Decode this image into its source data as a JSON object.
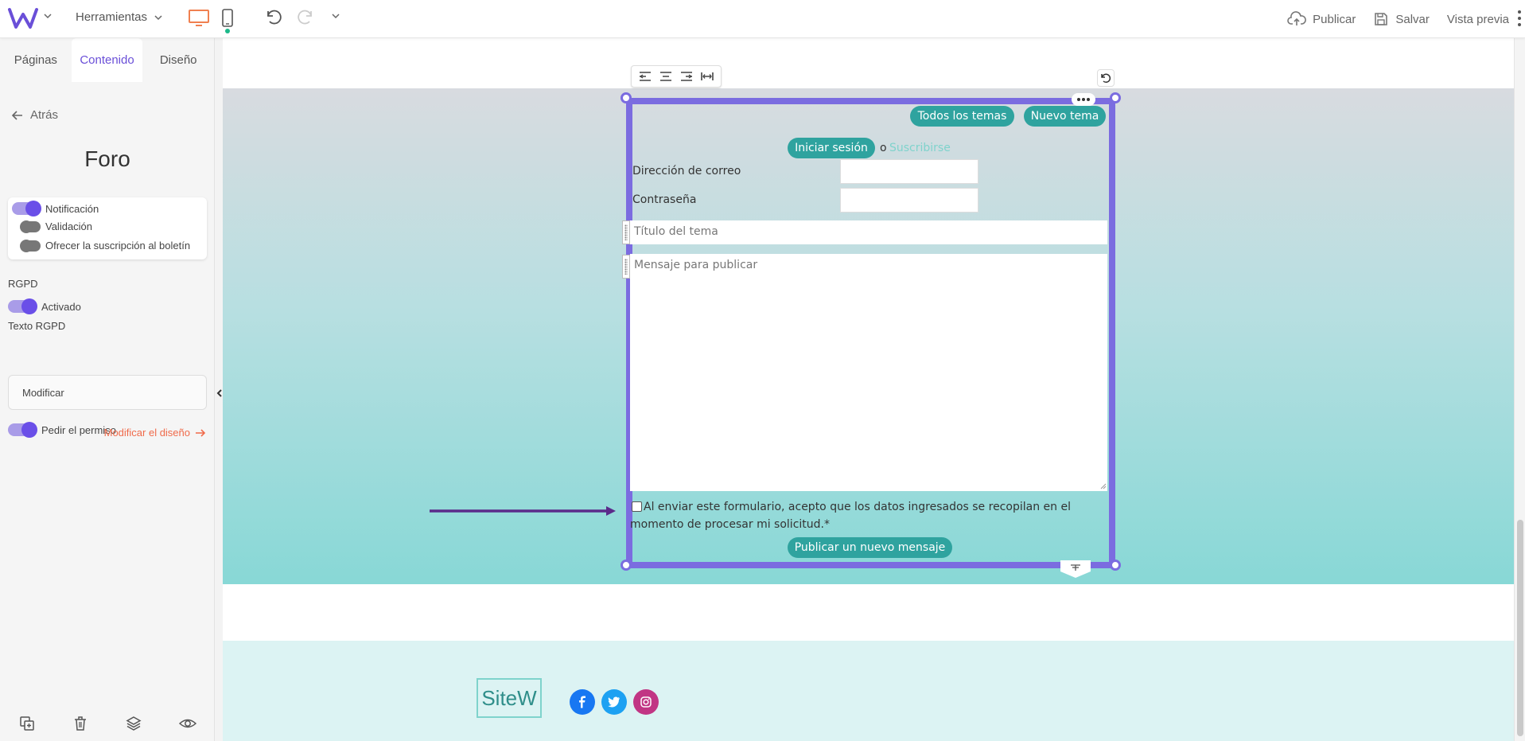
{
  "topbar": {
    "tools_label": "Herramientas",
    "publish_label": "Publicar",
    "save_label": "Salvar",
    "preview_label": "Vista previa",
    "colors": {
      "accent": "#6a4fd8",
      "desktop_icon": "#f08050",
      "mobile_dot": "#1cb98a"
    }
  },
  "left_panel": {
    "tabs": [
      {
        "label": "Páginas"
      },
      {
        "label": "Contenido"
      },
      {
        "label": "Diseño"
      }
    ],
    "back_label": "Atrás",
    "title": "Foro",
    "options": [
      {
        "label": "Notificación",
        "on": true
      },
      {
        "label": "Validación",
        "on": false
      },
      {
        "label": "Ofrecer la suscripción al boletín",
        "on": false
      }
    ],
    "rgpd_heading": "RGPD",
    "rgpd_activated_label": "Activado",
    "rgpd_text_heading": "Texto RGPD",
    "modify_button": "Modificar",
    "ask_permission_label": "Pedir el permiso",
    "modify_design_link": "Modificar el diseño",
    "bottom_icons": [
      "duplicate-icon",
      "trash-icon",
      "layers-icon",
      "eye-icon"
    ]
  },
  "forum": {
    "all_topics_button": "Todos los temas",
    "new_topic_button": "Nuevo tema",
    "login_button": "Iniciar sesión",
    "or_text": "o",
    "subscribe_link": "Suscribirse",
    "email_label": "Dirección de correo",
    "password_label": "Contraseña",
    "topic_title_placeholder": "Título del tema",
    "message_placeholder": "Mensaje para publicar",
    "consent_text": "Al enviar este formulario, acepto que los datos ingresados se recopilan en el momento de procesar mi solicitud.*",
    "post_button": "Publicar un nuevo mensaje",
    "colors": {
      "button": "#2fa39f",
      "frame": "#7b6ce0"
    }
  },
  "footer": {
    "logo_text": "SiteW",
    "social": [
      {
        "name": "facebook-icon",
        "color": "#1877f2"
      },
      {
        "name": "twitter-icon",
        "color": "#1da1f2"
      },
      {
        "name": "instagram-icon",
        "color": "#c13584"
      }
    ]
  }
}
